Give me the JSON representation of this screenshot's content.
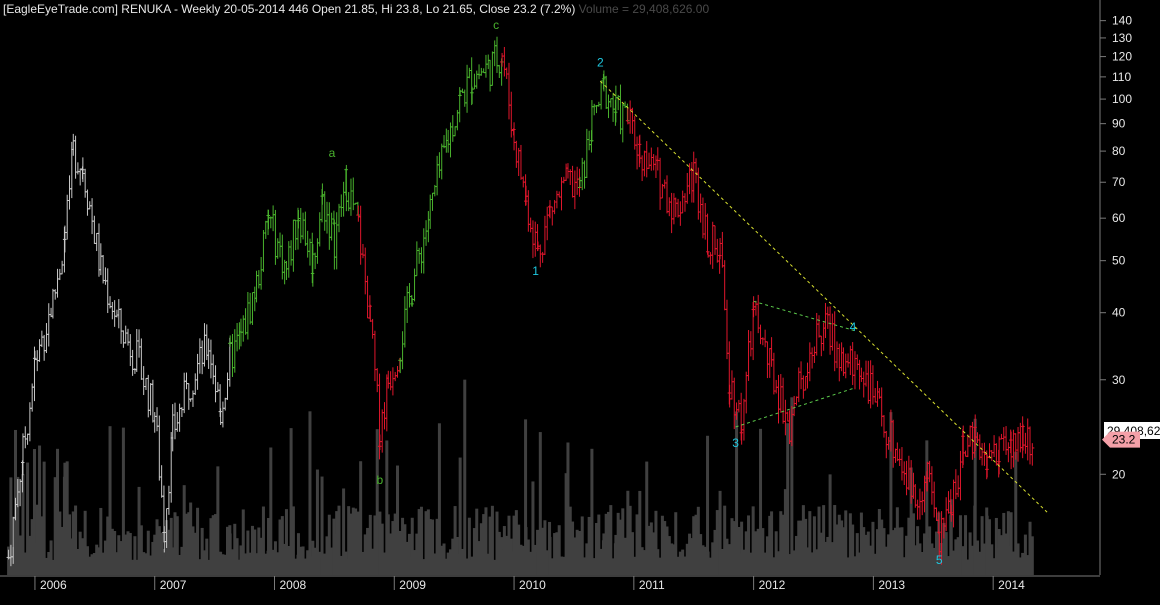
{
  "header": {
    "title": "[EagleEyeTrade.com] RENUKA - Weekly 20-05-2014 446 Open 21.85, Hi 23.8, Lo 21.65, Close 23.2 (7.2%)",
    "volume_label": "Volume = 29,408,626.00"
  },
  "colors": {
    "background": "#000000",
    "up_trend": "#49b22d",
    "down_trend": "#e0162c",
    "neutral": "#c8c8c8",
    "volume": "#404040",
    "wave_label": "#1ec8e0",
    "abc_label": "#49b22d",
    "trendline": "#d8e030",
    "triangle": "#5cc94b",
    "volume_badge_bg": "#ffffff",
    "price_badge_bg": "#f4a0a8"
  },
  "chart_data": {
    "type": "ohlc",
    "title": "RENUKA - Weekly",
    "y_scale": "log",
    "ylim": [
      13,
      148
    ],
    "y_ticks": [
      20,
      30,
      40,
      50,
      60,
      70,
      80,
      90,
      100,
      110,
      120,
      130,
      140
    ],
    "x_ticks": [
      "2006",
      "2007",
      "2008",
      "2009",
      "2010",
      "2011",
      "2012",
      "2013",
      "2014"
    ],
    "xlim": [
      2005.75,
      2014.75
    ],
    "price_path": [
      [
        2005.78,
        14,
        "neutral"
      ],
      [
        2005.9,
        22,
        "neutral"
      ],
      [
        2006.0,
        32,
        "neutral"
      ],
      [
        2006.15,
        42,
        "neutral"
      ],
      [
        2006.25,
        55,
        "neutral"
      ],
      [
        2006.32,
        80,
        "neutral"
      ],
      [
        2006.4,
        75,
        "neutral"
      ],
      [
        2006.55,
        48,
        "neutral"
      ],
      [
        2006.7,
        38,
        "neutral"
      ],
      [
        2006.85,
        33,
        "neutral"
      ],
      [
        2007.0,
        26,
        "neutral"
      ],
      [
        2007.08,
        16,
        "neutral"
      ],
      [
        2007.15,
        24,
        "neutral"
      ],
      [
        2007.3,
        30,
        "neutral"
      ],
      [
        2007.45,
        35,
        "neutral"
      ],
      [
        2007.55,
        26,
        "neutral"
      ],
      [
        2007.63,
        33,
        "neutral"
      ],
      [
        2007.72,
        36,
        "up"
      ],
      [
        2007.85,
        45,
        "up"
      ],
      [
        2007.95,
        60,
        "up"
      ],
      [
        2008.1,
        48,
        "up"
      ],
      [
        2008.2,
        62,
        "up"
      ],
      [
        2008.32,
        50,
        "up"
      ],
      [
        2008.4,
        65,
        "up"
      ],
      [
        2008.5,
        55,
        "up"
      ],
      [
        2008.6,
        70,
        "up"
      ],
      [
        2008.7,
        58,
        "up"
      ],
      [
        2008.8,
        38,
        "down"
      ],
      [
        2008.88,
        24,
        "down"
      ],
      [
        2008.95,
        30,
        "down"
      ],
      [
        2009.05,
        35,
        "down"
      ],
      [
        2009.15,
        45,
        "up"
      ],
      [
        2009.3,
        62,
        "up"
      ],
      [
        2009.45,
        85,
        "up"
      ],
      [
        2009.55,
        100,
        "up"
      ],
      [
        2009.65,
        110,
        "up"
      ],
      [
        2009.8,
        115,
        "up"
      ],
      [
        2009.9,
        122,
        "up"
      ],
      [
        2010.0,
        85,
        "down"
      ],
      [
        2010.1,
        65,
        "down"
      ],
      [
        2010.2,
        52,
        "down"
      ],
      [
        2010.3,
        62,
        "down"
      ],
      [
        2010.45,
        70,
        "down"
      ],
      [
        2010.55,
        68,
        "down"
      ],
      [
        2010.65,
        90,
        "up"
      ],
      [
        2010.75,
        105,
        "up"
      ],
      [
        2010.85,
        95,
        "up"
      ],
      [
        2010.95,
        92,
        "up"
      ],
      [
        2011.05,
        80,
        "down"
      ],
      [
        2011.2,
        72,
        "down"
      ],
      [
        2011.35,
        62,
        "down"
      ],
      [
        2011.5,
        73,
        "down"
      ],
      [
        2011.62,
        55,
        "down"
      ],
      [
        2011.72,
        52,
        "down"
      ],
      [
        2011.8,
        30,
        "down"
      ],
      [
        2011.9,
        25,
        "down"
      ],
      [
        2012.0,
        40,
        "down"
      ],
      [
        2012.15,
        31,
        "down"
      ],
      [
        2012.3,
        25,
        "down"
      ],
      [
        2012.45,
        33,
        "down"
      ],
      [
        2012.6,
        38,
        "down"
      ],
      [
        2012.75,
        32,
        "down"
      ],
      [
        2012.9,
        32,
        "down"
      ],
      [
        2013.05,
        26,
        "down"
      ],
      [
        2013.2,
        22,
        "down"
      ],
      [
        2013.35,
        18,
        "down"
      ],
      [
        2013.45,
        20,
        "down"
      ],
      [
        2013.55,
        15,
        "down"
      ],
      [
        2013.65,
        18,
        "down"
      ],
      [
        2013.75,
        22,
        "down"
      ],
      [
        2013.85,
        24,
        "down"
      ],
      [
        2013.95,
        21,
        "down"
      ],
      [
        2014.05,
        23,
        "down"
      ],
      [
        2014.15,
        22,
        "down"
      ],
      [
        2014.25,
        24,
        "down"
      ],
      [
        2014.34,
        23.2,
        "down"
      ]
    ],
    "wave_labels": [
      {
        "text": "c",
        "x": 2009.85,
        "y": 135,
        "kind": "abc"
      },
      {
        "text": "a",
        "x": 2008.48,
        "y": 78,
        "kind": "abc"
      },
      {
        "text": "b",
        "x": 2008.88,
        "y": 19.2,
        "kind": "abc"
      },
      {
        "text": "1",
        "x": 2010.18,
        "y": 47,
        "kind": "wave"
      },
      {
        "text": "2",
        "x": 2010.72,
        "y": 115,
        "kind": "wave"
      },
      {
        "text": "3",
        "x": 2011.85,
        "y": 22.5,
        "kind": "wave"
      },
      {
        "text": "4",
        "x": 2012.83,
        "y": 37,
        "kind": "wave"
      },
      {
        "text": "5",
        "x": 2013.55,
        "y": 13.6,
        "kind": "wave"
      }
    ],
    "trendline": [
      [
        2010.72,
        108
      ],
      [
        2014.45,
        17
      ]
    ],
    "triangle_upper": [
      [
        2012.0,
        42
      ],
      [
        2012.85,
        37
      ]
    ],
    "triangle_lower": [
      [
        2011.85,
        24.5
      ],
      [
        2012.85,
        29
      ]
    ],
    "current_volume_label": "29,408,62",
    "current_price_label": "23.2",
    "current_price": 23.2
  }
}
